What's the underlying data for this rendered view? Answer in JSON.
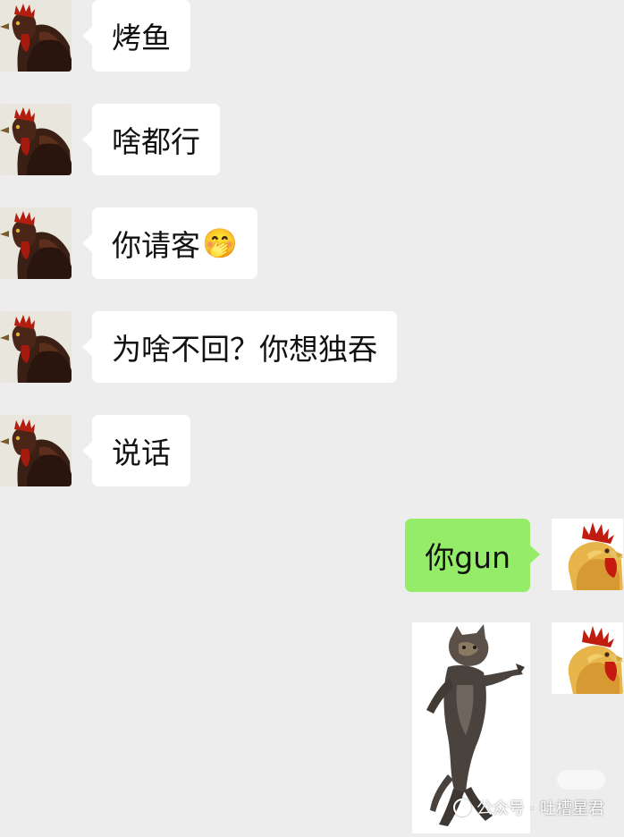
{
  "colors": {
    "background": "#ededed",
    "incoming_bubble": "#ffffff",
    "outgoing_bubble": "#95ec69"
  },
  "messages": [
    {
      "sender": "contact",
      "text": "烤鱼"
    },
    {
      "sender": "contact",
      "text": "啥都行"
    },
    {
      "sender": "contact",
      "text": "你请客",
      "emoji": "🤭"
    },
    {
      "sender": "contact",
      "text": "为啥不回？你想独吞"
    },
    {
      "sender": "contact",
      "text": "说话"
    },
    {
      "sender": "me",
      "text": "你gun"
    },
    {
      "sender": "me",
      "type": "sticker",
      "icon": "dancing-cat-sticker"
    }
  ],
  "avatars": {
    "contact": "dark-rooster-avatar-icon",
    "me": "yellow-rooster-avatar-icon"
  },
  "watermark": {
    "text": "公众号 · 吐槽星君"
  }
}
